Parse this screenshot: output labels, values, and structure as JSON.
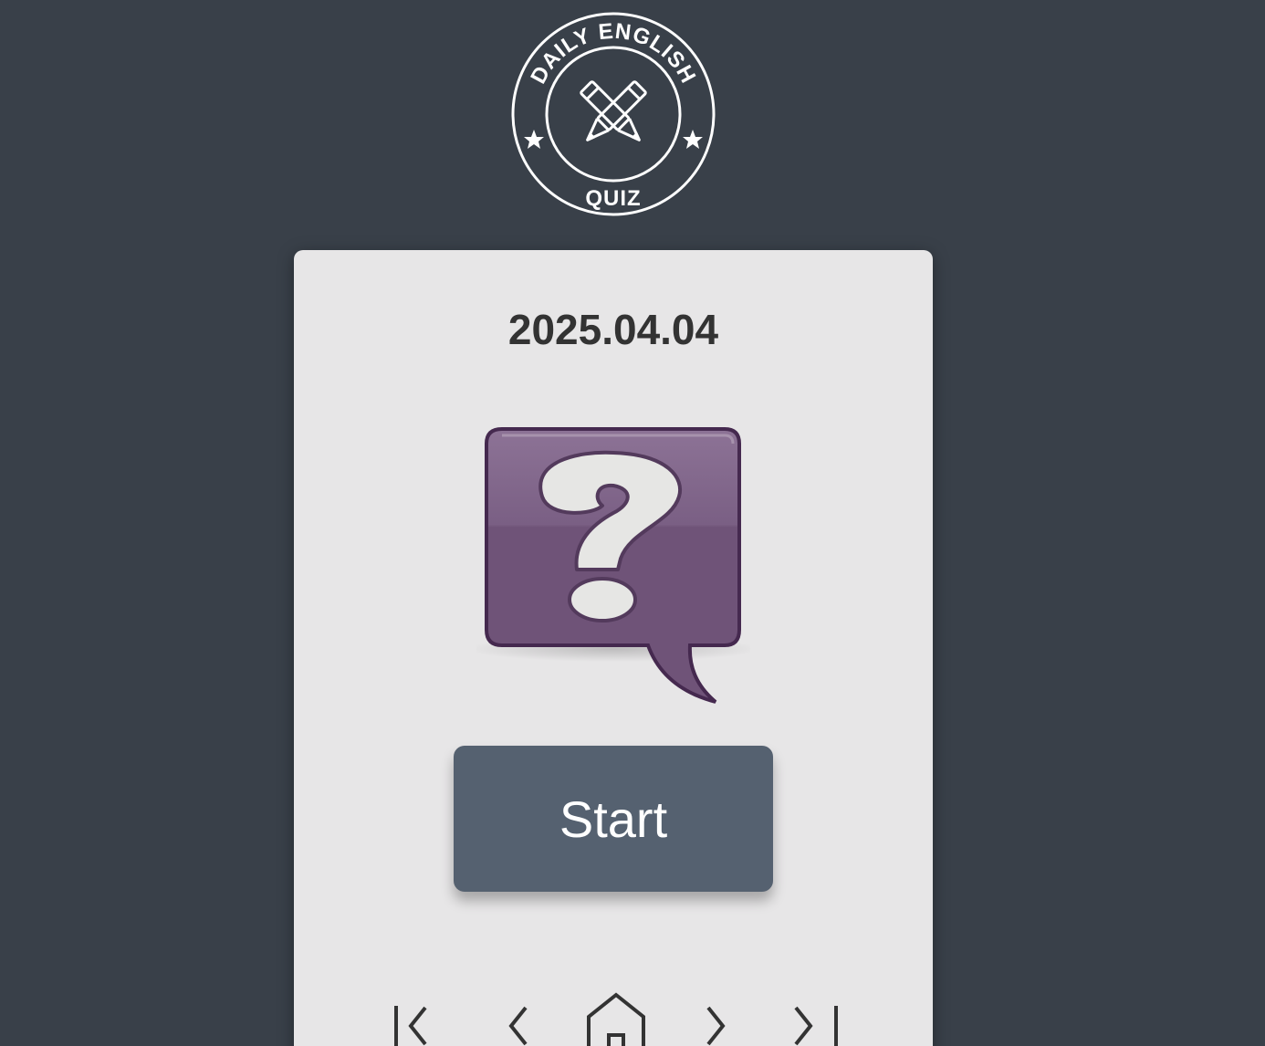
{
  "logo": {
    "top_text": "DAILY ENGLISH",
    "bottom_text": "QUIZ",
    "icon": "crossed-pencils-icon"
  },
  "quiz": {
    "date": "2025.04.04",
    "illustration": "question-mark-bubble-icon",
    "start_label": "Start"
  },
  "nav": {
    "first_icon": "first-page-icon",
    "prev_icon": "chevron-left-icon",
    "home_icon": "home-icon",
    "next_icon": "chevron-right-icon",
    "last_icon": "last-page-icon"
  },
  "colors": {
    "background": "#394049",
    "card": "#e7e6e7",
    "button": "#556170",
    "accent_purple": "#6f5378"
  }
}
